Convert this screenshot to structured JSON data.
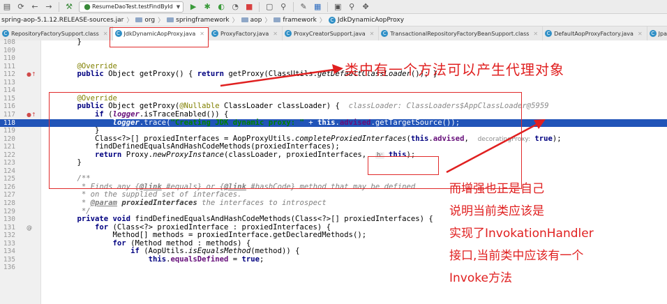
{
  "toolbar": {
    "run_config": "ResumeDaoTest.testFindById"
  },
  "breadcrumb": [
    "spring-aop-5.1.12.RELEASE-sources.jar",
    "org",
    "springframework",
    "aop",
    "framework",
    "JdkDynamicAopProxy"
  ],
  "tabs": [
    {
      "label": "RepositoryFactorySupport.class",
      "active": false
    },
    {
      "label": "JdkDynamicAopProxy.java",
      "active": true
    },
    {
      "label": "ProxyFactory.java",
      "active": false
    },
    {
      "label": "ProxyCreatorSupport.java",
      "active": false
    },
    {
      "label": "TransactionalRepositoryFactoryBeanSupport.class",
      "active": false
    },
    {
      "label": "DefaultAopProxyFactory.java",
      "active": false
    },
    {
      "label": "JpaRepository",
      "active": false
    }
  ],
  "line_numbers": [
    "108",
    "109",
    "110",
    "111",
    "112",
    "113",
    "114",
    "115",
    "116",
    "117",
    "118",
    "119",
    "120",
    "121",
    "122",
    "123",
    "124",
    "125",
    "126",
    "127",
    "128",
    "129",
    "130",
    "131",
    "132",
    "133",
    "134",
    "135",
    "136"
  ],
  "inline_hints": {
    "classloader_value": "classLoader: ClassLoaders$AppClassLoader@5959",
    "decorating_proxy": "decoratingProxy:",
    "h_label": "h:"
  },
  "annotations": {
    "top": "类中有一个方法可以产生代理对象",
    "bottom": [
      "而增强也正是自己",
      "说明当前类应该是",
      "实现了InvokationHandler",
      "接口,当前类中应该有一个",
      "Invoke方法"
    ]
  },
  "colors": {
    "annotation": "#e02020",
    "highlight_line": "#2154b8",
    "keyword": "#000080"
  }
}
